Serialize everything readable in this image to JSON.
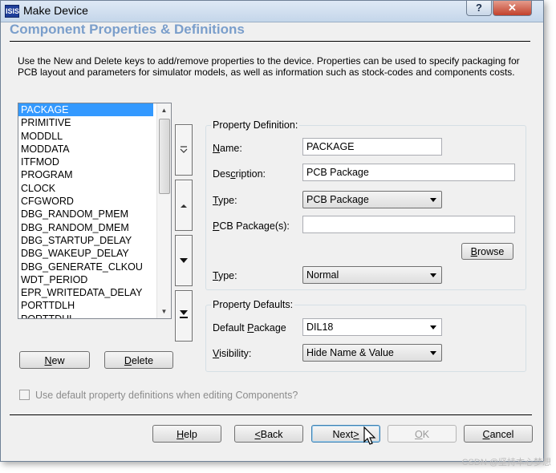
{
  "window": {
    "app_icon_text": "ISIS",
    "title": "Make Device",
    "help_glyph": "?",
    "close_glyph": "✕"
  },
  "heading": "Component Properties & Definitions",
  "intro": "Use the New and Delete keys to add/remove properties to the device. Properties can be used to specify packaging for PCB layout and parameters for simulator models, as well as information such as stock-codes and components costs.",
  "property_list": {
    "items": [
      "PACKAGE",
      "PRIMITIVE",
      "MODDLL",
      "MODDATA",
      "ITFMOD",
      "PROGRAM",
      "CLOCK",
      "CFGWORD",
      "DBG_RANDOM_PMEM",
      "DBG_RANDOM_DMEM",
      "DBG_STARTUP_DELAY",
      "DBG_WAKEUP_DELAY",
      "DBG_GENERATE_CLKOU",
      "WDT_PERIOD",
      "EPR_WRITEDATA_DELAY",
      "PORTTDLH",
      "PORTTDHL"
    ],
    "selected": "PACKAGE"
  },
  "list_buttons": {
    "new_prefix": "",
    "new_key": "N",
    "new_rest": "ew",
    "delete_prefix": "",
    "delete_key": "D",
    "delete_rest": "elete"
  },
  "property_definition": {
    "group_title": "Property Definition:",
    "name_label_key": "N",
    "name_label_rest": "ame:",
    "name_value": "PACKAGE",
    "description_label_pre": "Des",
    "description_label_key": "c",
    "description_label_rest": "ription:",
    "description_value": "PCB Package",
    "type_label_key": "T",
    "type_label_rest": "ype:",
    "type_value": "PCB Package",
    "pcb_label_key": "P",
    "pcb_label_rest": "CB Package(s):",
    "pcb_value": "",
    "browse_key": "B",
    "browse_rest": "rowse",
    "type2_label_key": "T",
    "type2_label_rest": "ype:",
    "type2_value": "Normal"
  },
  "property_defaults": {
    "group_title": "Property Defaults:",
    "default_pkg_label_pre": "Default ",
    "default_pkg_label_key": "P",
    "default_pkg_label_rest": "ackage",
    "default_pkg_value": "DIL18",
    "visibility_label_key": "V",
    "visibility_label_rest": "isibility:",
    "visibility_value": "Hide Name & Value"
  },
  "checkbox": {
    "label": "Use default property definitions when editing Components?",
    "checked": false
  },
  "footer": {
    "help_key": "H",
    "help_rest": "elp",
    "back_key": "<",
    "back_rest": "Back",
    "next_pre": "Next",
    "next_key": ">",
    "ok_key": "O",
    "ok_rest": "K",
    "cancel_key": "C",
    "cancel_rest": "ancel"
  },
  "watermark": "CSDN @坚持本心梦想"
}
